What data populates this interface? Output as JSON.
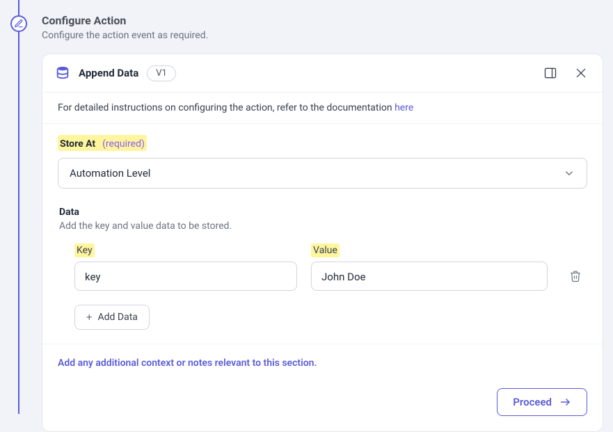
{
  "header": {
    "title": "Configure Action",
    "subtitle": "Configure the action event as required."
  },
  "card": {
    "title": "Append Data",
    "version": "V1"
  },
  "instructions": {
    "text": "For detailed instructions on configuring the action, refer to the documentation ",
    "link_text": "here"
  },
  "store_at": {
    "label": "Store At",
    "required_text": "(required)",
    "value": "Automation Level"
  },
  "data_block": {
    "label": "Data",
    "description": "Add the key and value data to be stored.",
    "columns": {
      "key": "Key",
      "value": "Value"
    },
    "rows": [
      {
        "key": "key",
        "value": "John Doe"
      }
    ],
    "add_button": "Add Data"
  },
  "notes_link": "Add any additional context or notes relevant to this section.",
  "footer": {
    "proceed": "Proceed"
  }
}
